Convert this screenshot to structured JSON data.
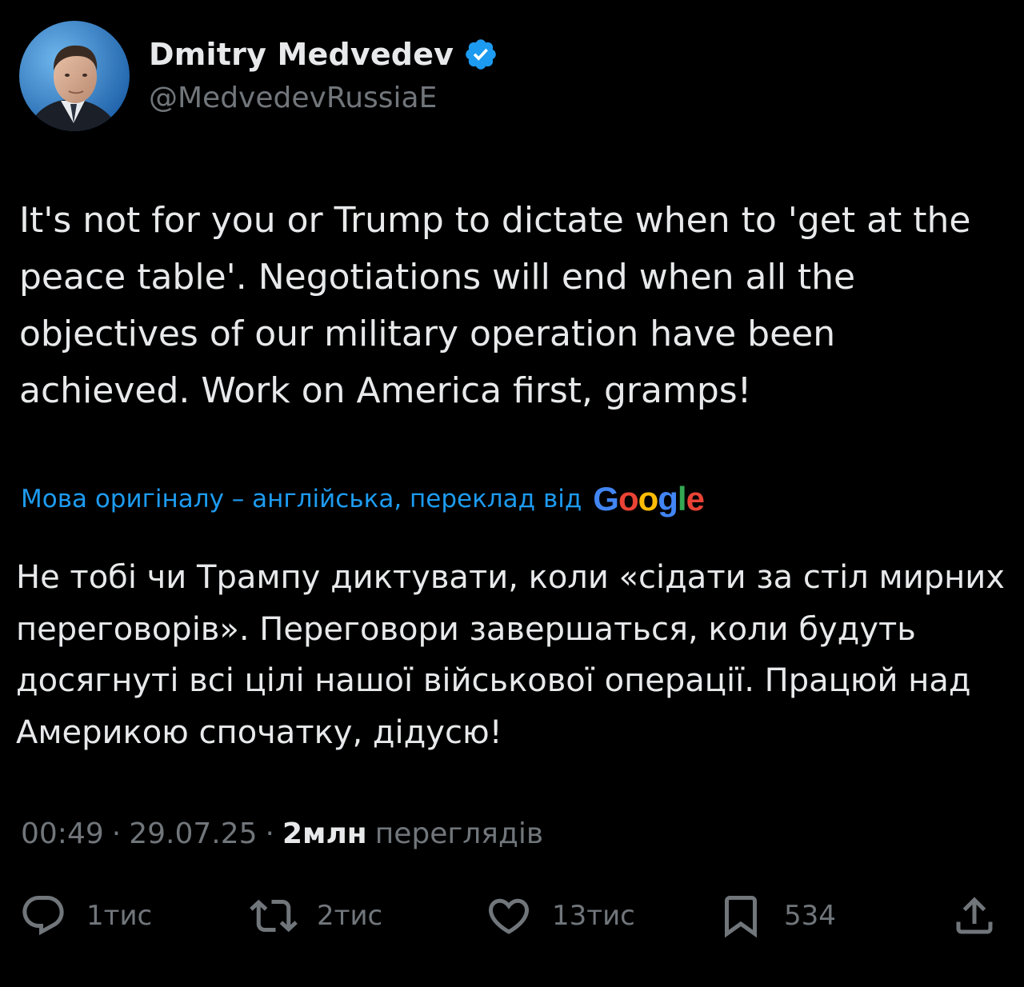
{
  "author": {
    "name": "Dmitry Medvedev",
    "handle": "@MedvedevRussiaE",
    "verified_color": "#1d9bf0"
  },
  "tweet": {
    "text": "It's not for you or Trump to dictate when to 'get at the peace table'. Negotiations will end when all the objectives of our military operation have been achieved. Work on America first, gramps!"
  },
  "translation": {
    "label": "Мова оригіналу – англійська, переклад від",
    "provider": "Google",
    "provider_colors": [
      "#4285f4",
      "#ea4335",
      "#fbbc05",
      "#4285f4",
      "#34a853",
      "#ea4335"
    ],
    "text": "Не тобі чи Трампу диктувати, коли «сідати за стіл мирних переговорів». Переговори завершаться, коли будуть досягнуті всі цілі нашої військової операції. Працюй над Америкою спочатку, дідусю!"
  },
  "meta": {
    "time": "00:49",
    "date": "29.07.25",
    "views_count": "2млн",
    "views_label": "переглядів"
  },
  "actions": {
    "replies": "1тис",
    "reposts": "2тис",
    "likes": "13тис",
    "bookmarks": "534"
  },
  "icons": {
    "reply": "reply-icon",
    "repost": "repost-icon",
    "like": "like-icon",
    "bookmark": "bookmark-icon",
    "share": "share-icon",
    "verified": "verified-badge-icon"
  },
  "colors": {
    "background": "#000000",
    "text_primary": "#e7e9ea",
    "text_secondary": "#71767b",
    "link": "#1d9bf0"
  }
}
